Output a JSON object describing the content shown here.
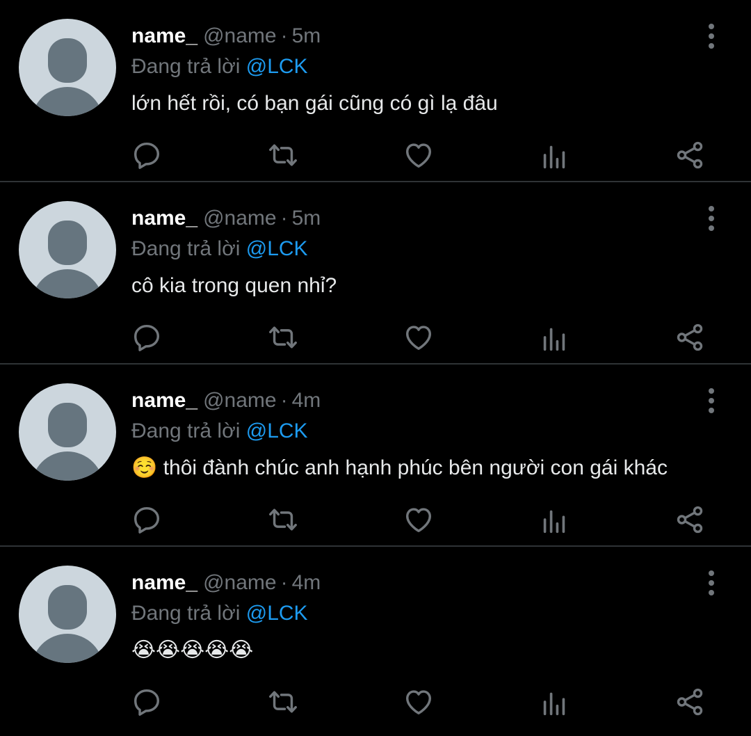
{
  "tweets": [
    {
      "display_name": "name_",
      "handle": "@name",
      "separator": "·",
      "time": "5m",
      "reply_prefix": "Đang trả lời",
      "reply_to": "@LCK",
      "text": "lớn hết rồi, có bạn gái cũng có gì lạ đâu"
    },
    {
      "display_name": "name_",
      "handle": "@name",
      "separator": "·",
      "time": "5m",
      "reply_prefix": "Đang trả lời",
      "reply_to": "@LCK",
      "text": "cô kia trong quen nhỉ?"
    },
    {
      "display_name": "name_",
      "handle": "@name",
      "separator": "·",
      "time": "4m",
      "reply_prefix": "Đang trả lời",
      "reply_to": "@LCK",
      "text": "☺️ thôi đành chúc anh hạnh phúc bên người con gái khác"
    },
    {
      "display_name": "name_",
      "handle": "@name",
      "separator": "·",
      "time": "4m",
      "reply_prefix": "Đang trả lời",
      "reply_to": "@LCK",
      "text": "😭😭😭😭😭"
    }
  ],
  "icons": {
    "more": "more-vertical-icon",
    "reply": "reply-icon",
    "retweet": "retweet-icon",
    "like": "heart-icon",
    "views": "analytics-icon",
    "share": "share-icon"
  },
  "colors": {
    "background": "#000000",
    "text": "#e7e9ea",
    "secondary": "#71767b",
    "accent": "#1d9bf0",
    "divider": "#2f3336",
    "avatar_bg": "#ccd6dd",
    "avatar_fg": "#66757f"
  }
}
